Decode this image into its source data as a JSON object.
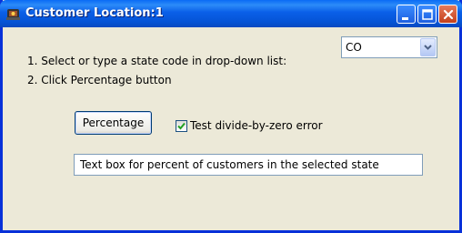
{
  "window": {
    "title": "Customer Location:1",
    "icon": "app-icon"
  },
  "title_buttons": {
    "minimize": "minimize-icon",
    "maximize": "maximize-icon",
    "close": "close-icon"
  },
  "instructions": {
    "step1": "1. Select or type a state code in drop-down list:",
    "step2": "2. Click Percentage button"
  },
  "state_combo": {
    "value": "CO"
  },
  "percentage_button": {
    "label": "Percentage"
  },
  "divide_by_zero_checkbox": {
    "label": "Test divide-by-zero error",
    "checked": true
  },
  "result_textbox": {
    "value": "Text box for percent of customers in the selected state"
  },
  "colors": {
    "titlebar": "#0A5FE8",
    "window_bg": "#ECE9D8",
    "close_button": "#C4401C"
  }
}
